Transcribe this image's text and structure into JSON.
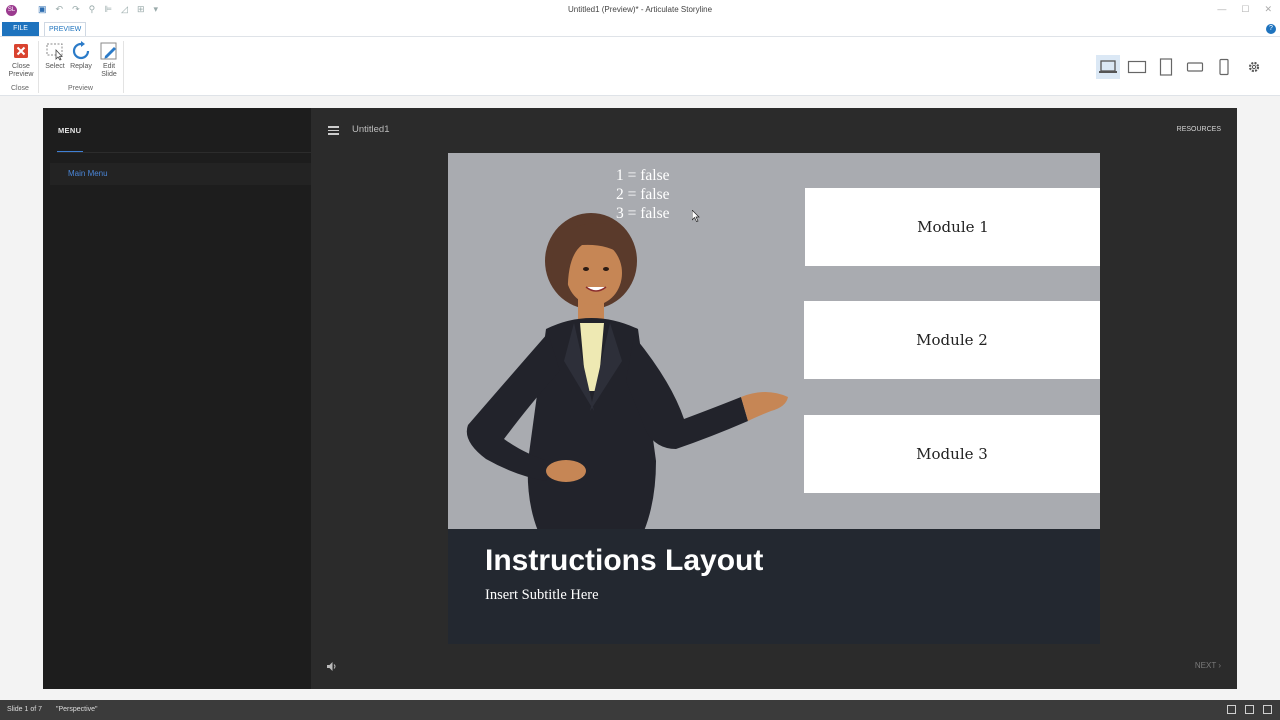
{
  "window": {
    "title": "Untitled1 (Preview)* - Articulate Storyline",
    "app_icon": "SL"
  },
  "ribbon_tabs": {
    "file": "FILE",
    "preview": "PREVIEW"
  },
  "ribbon": {
    "close_preview": "Close Preview",
    "close_group": "Close",
    "select": "Select",
    "replay": "Replay",
    "edit_slide": "Edit Slide",
    "preview_group": "Preview"
  },
  "player": {
    "menu_title": "MENU",
    "menu_items": [
      "Main Menu"
    ],
    "course_title": "Untitled1",
    "resources": "RESOURCES",
    "next": "NEXT"
  },
  "slide": {
    "variables": [
      "1 = false",
      "2 = false",
      "3 = false"
    ],
    "modules": [
      "Module 1",
      "Module 2",
      "Module 3"
    ],
    "title": "Instructions Layout",
    "subtitle": "Insert Subtitle Here"
  },
  "status": {
    "slide": "Slide 1 of 7",
    "theme": "\"Perspective\""
  },
  "colors": {
    "accent": "#1e73be",
    "menu_link": "#4a86d8",
    "player_bg": "#2b2b2b",
    "sidebar_bg": "#1d1d1d",
    "slide_bg": "#a9abb0",
    "banner_bg": "#232830"
  }
}
